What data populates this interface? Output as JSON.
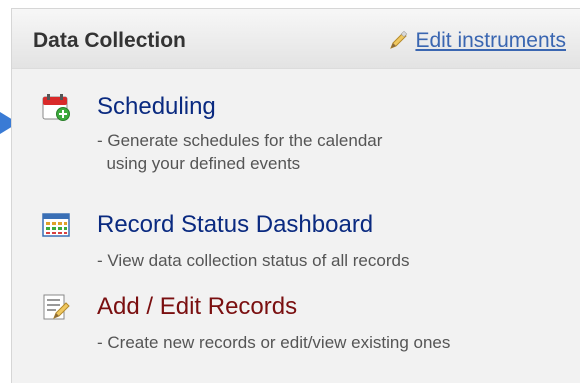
{
  "panel": {
    "title": "Data Collection",
    "edit_link": "Edit instruments"
  },
  "items": [
    {
      "title": "Scheduling",
      "desc_line1": "- Generate schedules for the calendar",
      "desc_line2": "  using your defined events",
      "icon": "calendar-add-icon",
      "color": "#0a2a80"
    },
    {
      "title": "Record Status Dashboard",
      "desc_line1": "- View data collection status of all records",
      "icon": "dashboard-grid-icon",
      "color": "#0a2a80"
    },
    {
      "title": "Add / Edit Records",
      "desc_line1": "- Create new records or edit/view existing ones",
      "icon": "edit-record-icon",
      "color": "#7a0f10"
    }
  ],
  "pointer": {
    "icon": "pointer-arrow-icon",
    "color": "#3a7bd5"
  }
}
